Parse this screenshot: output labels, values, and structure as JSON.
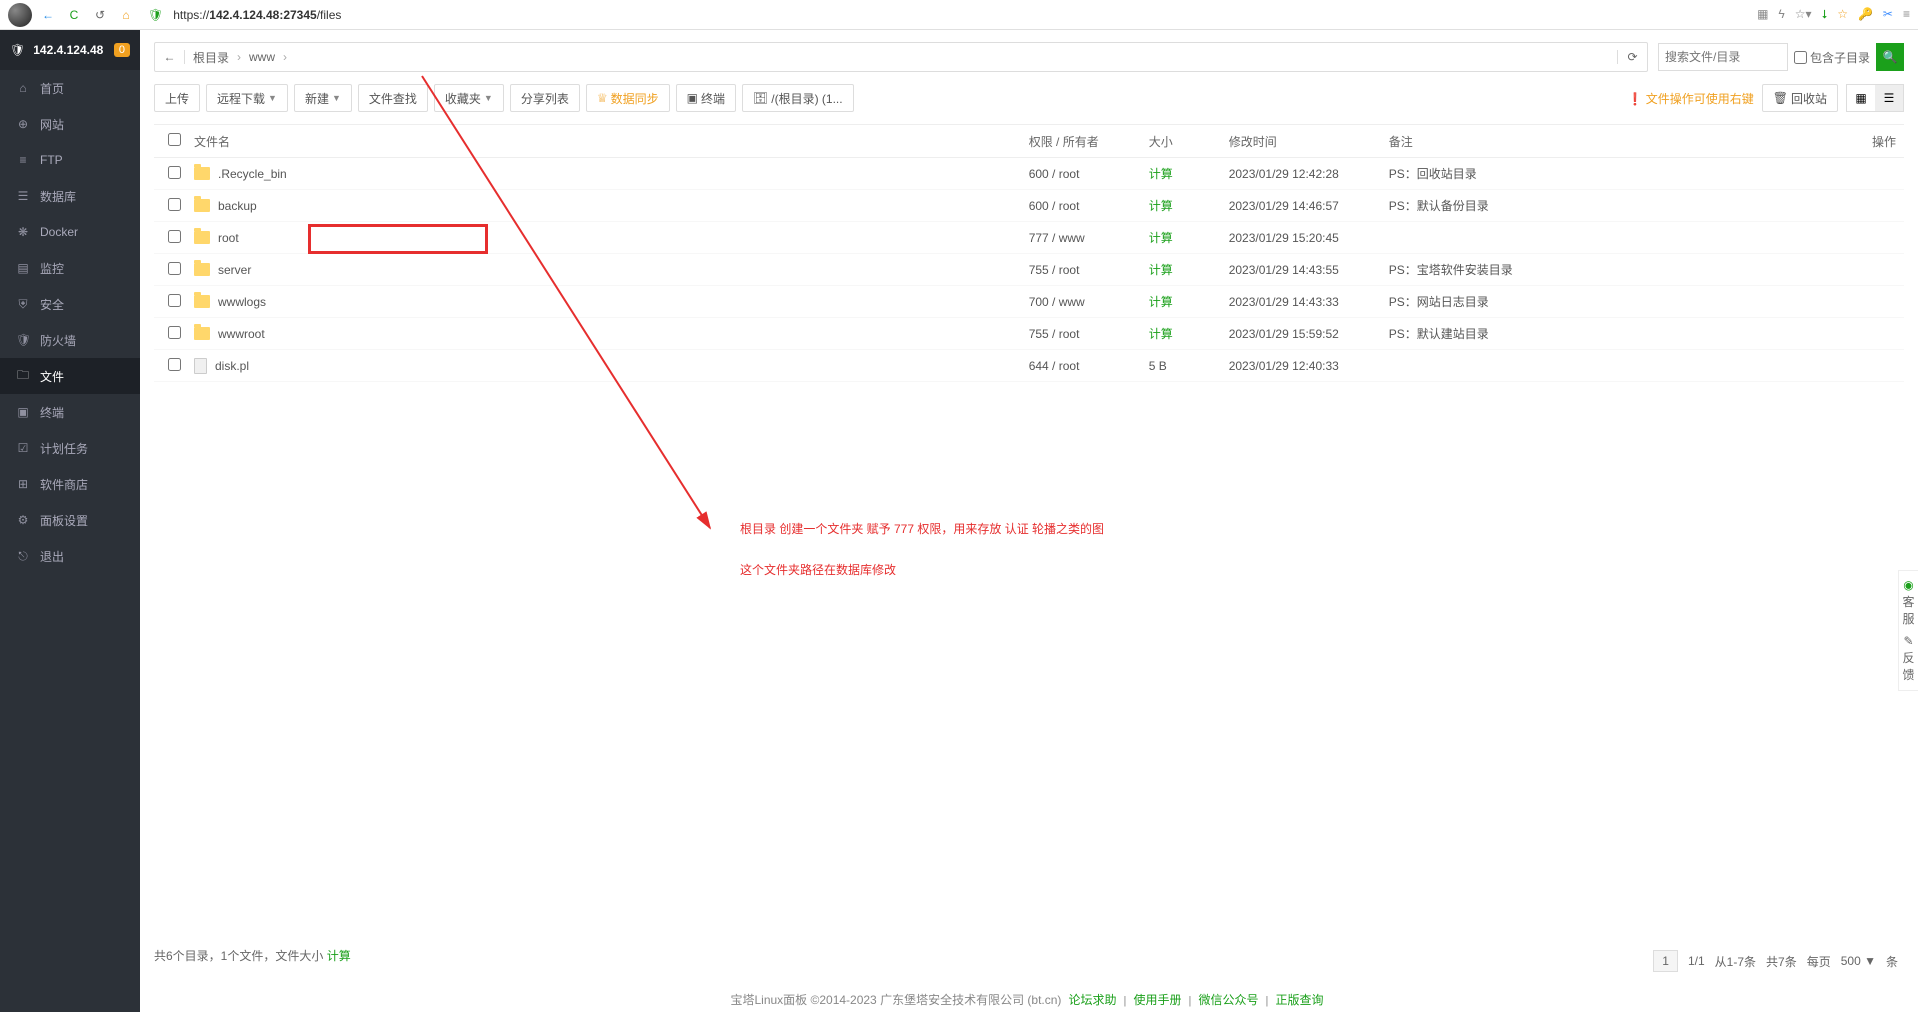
{
  "browser": {
    "url_host": "142.4.124.48:27345",
    "url_path": "/files",
    "url_prefix": "https://"
  },
  "sidebar": {
    "ip": "142.4.124.48",
    "badge": "0",
    "items": [
      {
        "icon": "⌂",
        "label": "首页"
      },
      {
        "icon": "⊕",
        "label": "网站"
      },
      {
        "icon": "≡",
        "label": "FTP"
      },
      {
        "icon": "☰",
        "label": "数据库"
      },
      {
        "icon": "❋",
        "label": "Docker"
      },
      {
        "icon": "▤",
        "label": "监控"
      },
      {
        "icon": "⛨",
        "label": "安全"
      },
      {
        "icon": "🛡",
        "label": "防火墙"
      },
      {
        "icon": "🗀",
        "label": "文件"
      },
      {
        "icon": "▣",
        "label": "终端"
      },
      {
        "icon": "☑",
        "label": "计划任务"
      },
      {
        "icon": "⊞",
        "label": "软件商店"
      },
      {
        "icon": "⚙",
        "label": "面板设置"
      },
      {
        "icon": "⎋",
        "label": "退出"
      }
    ],
    "active": 8
  },
  "crumbs": [
    "根目录",
    "www"
  ],
  "search": {
    "placeholder": "搜索文件/目录",
    "include_sub": "包含子目录"
  },
  "toolbar": {
    "upload": "上传",
    "remote": "远程下载",
    "new": "新建",
    "find": "文件查找",
    "fav": "收藏夹",
    "share": "分享列表",
    "sync": "数据同步",
    "term": "终端",
    "disk": "/(根目录) (1...",
    "tip": "文件操作可使用右键",
    "recycle": "回收站"
  },
  "columns": {
    "name": "文件名",
    "perm": "权限 / 所有者",
    "size": "大小",
    "time": "修改时间",
    "note": "备注",
    "op": "操作"
  },
  "calc": "计算",
  "rows": [
    {
      "type": "folder",
      "name": ".Recycle_bin",
      "perm": "600 / root",
      "size": "",
      "time": "2023/01/29 12:42:28",
      "note": "PS：回收站目录"
    },
    {
      "type": "folder",
      "name": "backup",
      "perm": "600 / root",
      "size": "",
      "time": "2023/01/29 14:46:57",
      "note": "PS：默认备份目录"
    },
    {
      "type": "folder",
      "name": "root",
      "perm": "777 / www",
      "size": "",
      "time": "2023/01/29 15:20:45",
      "note": ""
    },
    {
      "type": "folder",
      "name": "server",
      "perm": "755 / root",
      "size": "",
      "time": "2023/01/29 14:43:55",
      "note": "PS：宝塔软件安装目录"
    },
    {
      "type": "folder",
      "name": "wwwlogs",
      "perm": "700 / www",
      "size": "",
      "time": "2023/01/29 14:43:33",
      "note": "PS：网站日志目录"
    },
    {
      "type": "folder",
      "name": "wwwroot",
      "perm": "755 / root",
      "size": "",
      "time": "2023/01/29 15:59:52",
      "note": "PS：默认建站目录"
    },
    {
      "type": "file",
      "name": "disk.pl",
      "perm": "644 / root",
      "size": "5 B",
      "time": "2023/01/29 12:40:33",
      "note": ""
    }
  ],
  "annotation": {
    "line1": "根目录 创建一个文件夹 赋予 777 权限，用来存放 认证 轮播之类的图",
    "line2": "这个文件夹路径在数据库修改"
  },
  "footer_info": "共6个目录，1个文件，文件大小 ",
  "pager": {
    "page": "1",
    "pages": "1/1",
    "range": "从1-7条",
    "total": "共7条",
    "perpage_label": "每页",
    "perpage": "500",
    "unit": "条"
  },
  "foot": {
    "copyright": "宝塔Linux面板 ©2014-2023 广东堡塔安全技术有限公司 (bt.cn)",
    "links": [
      "论坛求助",
      "使用手册",
      "微信公众号",
      "正版查询"
    ]
  },
  "float": {
    "a": "客服",
    "b": "反馈"
  }
}
